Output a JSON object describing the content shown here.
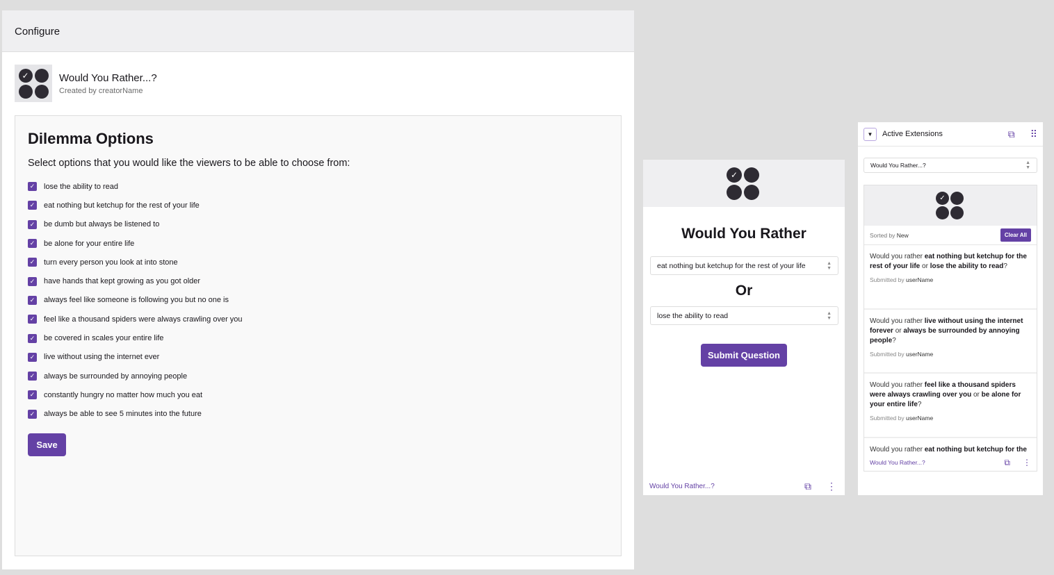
{
  "config": {
    "header": "Configure",
    "ext_title": "Would You Rather...?",
    "ext_sub": "Created by creatorName",
    "heading": "Dilemma Options",
    "desc": "Select options that you would like the viewers to be able to choose from:",
    "options": [
      {
        "label": "lose the ability to read",
        "checked": true
      },
      {
        "label": "eat nothing but ketchup for the rest of your life",
        "checked": true
      },
      {
        "label": "be dumb but always be listened to",
        "checked": true
      },
      {
        "label": "be alone for your entire life",
        "checked": true
      },
      {
        "label": "turn every person you look at into stone",
        "checked": true
      },
      {
        "label": "have hands that kept growing as you got older",
        "checked": true
      },
      {
        "label": "always feel like someone is following you but no one is",
        "checked": true
      },
      {
        "label": "feel like a thousand spiders were always crawling over you",
        "checked": true
      },
      {
        "label": "be covered in scales your entire life",
        "checked": true
      },
      {
        "label": "live without using the internet ever",
        "checked": true
      },
      {
        "label": "always be surrounded by annoying people",
        "checked": true
      },
      {
        "label": "constantly hungry no matter how much you eat",
        "checked": true
      },
      {
        "label": "always be able to see 5 minutes into the future",
        "checked": true
      }
    ],
    "save": "Save"
  },
  "viewer": {
    "title": "Would You Rather",
    "option1": "eat nothing but ketchup for the rest of your life",
    "or": "Or",
    "option2": "lose the ability to read",
    "submit": "Submit Question",
    "footer": "Would You Rather...?"
  },
  "dashboard": {
    "header": "Active Extensions",
    "select": "Would You Rather...?",
    "sorted_prefix": "Sorted by",
    "sorted": "New",
    "clear": "Clear All",
    "questions": [
      {
        "pre": "Would you rather",
        "a": "eat nothing but ketchup for the rest of your life",
        "or": "or",
        "b": "lose the ability to read",
        "q": "?",
        "sub": "Submitted by",
        "user": "userName"
      },
      {
        "pre": "Would you rather",
        "a": "live without using the internet forever",
        "or": "or",
        "b": "always be surrounded by annoying people",
        "q": "?",
        "sub": "Submitted by",
        "user": "userName"
      },
      {
        "pre": "Would you rather",
        "a": "feel like a thousand spiders were always crawling over you",
        "or": "or",
        "b": "be alone for your entire life",
        "q": "?",
        "sub": "Submitted by",
        "user": "userName"
      }
    ],
    "footer": "Would You Rather...?"
  },
  "colors": {
    "accent": "#6441a5"
  }
}
